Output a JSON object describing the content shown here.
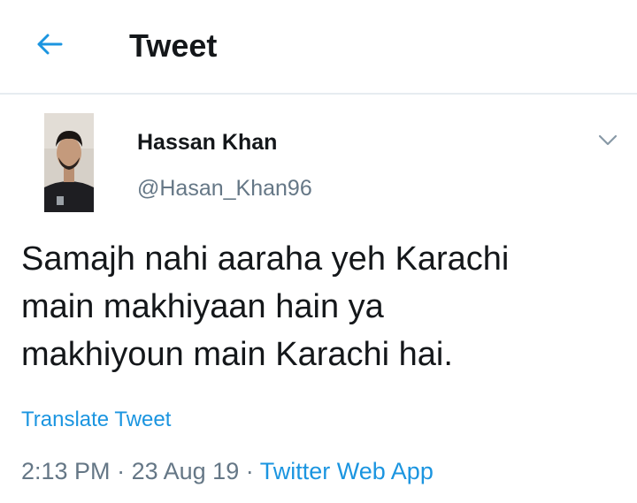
{
  "header": {
    "back_icon": "arrow-left-icon",
    "title": "Tweet"
  },
  "tweet": {
    "author": {
      "name": "Hassan Khan",
      "handle": "@Hasan_Khan96"
    },
    "menu_icon": "chevron-down-icon",
    "text": "Samajh nahi aaraha yeh Karachi\nmain makhiyaan hain ya\nmakhiyoun main Karachi hai.",
    "translate_label": "Translate Tweet",
    "time": "2:13 PM",
    "separator": "·",
    "date": "23 Aug 19",
    "source": "Twitter Web App"
  },
  "colors": {
    "accent": "#1b95e0",
    "text_primary": "#14171a",
    "text_secondary": "#657786",
    "divider": "#e6ecf0"
  }
}
